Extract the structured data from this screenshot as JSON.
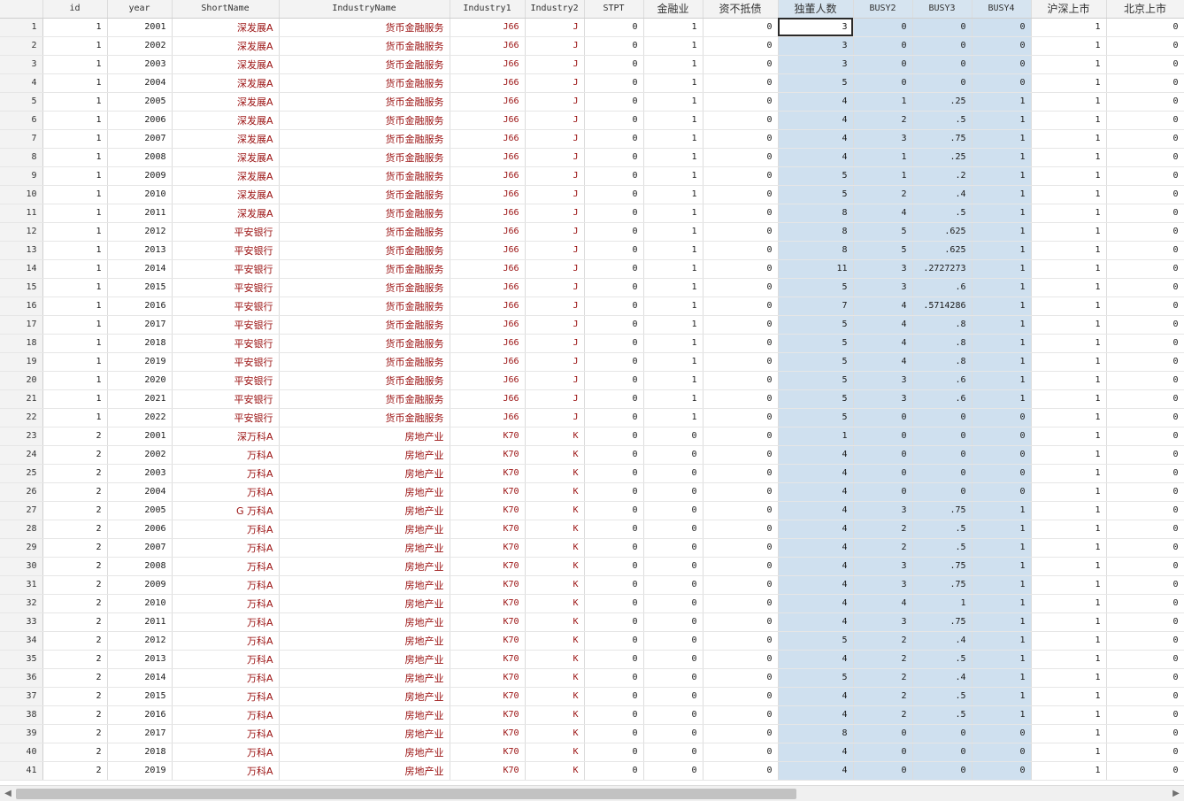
{
  "columns": [
    "id",
    "year",
    "ShortName",
    "IndustryName",
    "Industry1",
    "Industry2",
    "STPT",
    "金融业",
    "资不抵债",
    "独董人数",
    "BUSY2",
    "BUSY3",
    "BUSY4",
    "沪深上市",
    "北京上市"
  ],
  "rows": [
    [
      "1",
      "1",
      "2001",
      "深发展A",
      "货币金融服务",
      "J66",
      "J",
      "0",
      "1",
      "0",
      "3",
      "0",
      "0",
      "0",
      "1",
      "0"
    ],
    [
      "2",
      "1",
      "2002",
      "深发展A",
      "货币金融服务",
      "J66",
      "J",
      "0",
      "1",
      "0",
      "3",
      "0",
      "0",
      "0",
      "1",
      "0"
    ],
    [
      "3",
      "1",
      "2003",
      "深发展A",
      "货币金融服务",
      "J66",
      "J",
      "0",
      "1",
      "0",
      "3",
      "0",
      "0",
      "0",
      "1",
      "0"
    ],
    [
      "4",
      "1",
      "2004",
      "深发展A",
      "货币金融服务",
      "J66",
      "J",
      "0",
      "1",
      "0",
      "5",
      "0",
      "0",
      "0",
      "1",
      "0"
    ],
    [
      "5",
      "1",
      "2005",
      "深发展A",
      "货币金融服务",
      "J66",
      "J",
      "0",
      "1",
      "0",
      "4",
      "1",
      ".25",
      "1",
      "1",
      "0"
    ],
    [
      "6",
      "1",
      "2006",
      "深发展A",
      "货币金融服务",
      "J66",
      "J",
      "0",
      "1",
      "0",
      "4",
      "2",
      ".5",
      "1",
      "1",
      "0"
    ],
    [
      "7",
      "1",
      "2007",
      "深发展A",
      "货币金融服务",
      "J66",
      "J",
      "0",
      "1",
      "0",
      "4",
      "3",
      ".75",
      "1",
      "1",
      "0"
    ],
    [
      "8",
      "1",
      "2008",
      "深发展A",
      "货币金融服务",
      "J66",
      "J",
      "0",
      "1",
      "0",
      "4",
      "1",
      ".25",
      "1",
      "1",
      "0"
    ],
    [
      "9",
      "1",
      "2009",
      "深发展A",
      "货币金融服务",
      "J66",
      "J",
      "0",
      "1",
      "0",
      "5",
      "1",
      ".2",
      "1",
      "1",
      "0"
    ],
    [
      "10",
      "1",
      "2010",
      "深发展A",
      "货币金融服务",
      "J66",
      "J",
      "0",
      "1",
      "0",
      "5",
      "2",
      ".4",
      "1",
      "1",
      "0"
    ],
    [
      "11",
      "1",
      "2011",
      "深发展A",
      "货币金融服务",
      "J66",
      "J",
      "0",
      "1",
      "0",
      "8",
      "4",
      ".5",
      "1",
      "1",
      "0"
    ],
    [
      "12",
      "1",
      "2012",
      "平安银行",
      "货币金融服务",
      "J66",
      "J",
      "0",
      "1",
      "0",
      "8",
      "5",
      ".625",
      "1",
      "1",
      "0"
    ],
    [
      "13",
      "1",
      "2013",
      "平安银行",
      "货币金融服务",
      "J66",
      "J",
      "0",
      "1",
      "0",
      "8",
      "5",
      ".625",
      "1",
      "1",
      "0"
    ],
    [
      "14",
      "1",
      "2014",
      "平安银行",
      "货币金融服务",
      "J66",
      "J",
      "0",
      "1",
      "0",
      "11",
      "3",
      ".2727273",
      "1",
      "1",
      "0"
    ],
    [
      "15",
      "1",
      "2015",
      "平安银行",
      "货币金融服务",
      "J66",
      "J",
      "0",
      "1",
      "0",
      "5",
      "3",
      ".6",
      "1",
      "1",
      "0"
    ],
    [
      "16",
      "1",
      "2016",
      "平安银行",
      "货币金融服务",
      "J66",
      "J",
      "0",
      "1",
      "0",
      "7",
      "4",
      ".5714286",
      "1",
      "1",
      "0"
    ],
    [
      "17",
      "1",
      "2017",
      "平安银行",
      "货币金融服务",
      "J66",
      "J",
      "0",
      "1",
      "0",
      "5",
      "4",
      ".8",
      "1",
      "1",
      "0"
    ],
    [
      "18",
      "1",
      "2018",
      "平安银行",
      "货币金融服务",
      "J66",
      "J",
      "0",
      "1",
      "0",
      "5",
      "4",
      ".8",
      "1",
      "1",
      "0"
    ],
    [
      "19",
      "1",
      "2019",
      "平安银行",
      "货币金融服务",
      "J66",
      "J",
      "0",
      "1",
      "0",
      "5",
      "4",
      ".8",
      "1",
      "1",
      "0"
    ],
    [
      "20",
      "1",
      "2020",
      "平安银行",
      "货币金融服务",
      "J66",
      "J",
      "0",
      "1",
      "0",
      "5",
      "3",
      ".6",
      "1",
      "1",
      "0"
    ],
    [
      "21",
      "1",
      "2021",
      "平安银行",
      "货币金融服务",
      "J66",
      "J",
      "0",
      "1",
      "0",
      "5",
      "3",
      ".6",
      "1",
      "1",
      "0"
    ],
    [
      "22",
      "1",
      "2022",
      "平安银行",
      "货币金融服务",
      "J66",
      "J",
      "0",
      "1",
      "0",
      "5",
      "0",
      "0",
      "0",
      "1",
      "0"
    ],
    [
      "23",
      "2",
      "2001",
      "深万科A",
      "房地产业",
      "K70",
      "K",
      "0",
      "0",
      "0",
      "1",
      "0",
      "0",
      "0",
      "1",
      "0"
    ],
    [
      "24",
      "2",
      "2002",
      "万科A",
      "房地产业",
      "K70",
      "K",
      "0",
      "0",
      "0",
      "4",
      "0",
      "0",
      "0",
      "1",
      "0"
    ],
    [
      "25",
      "2",
      "2003",
      "万科A",
      "房地产业",
      "K70",
      "K",
      "0",
      "0",
      "0",
      "4",
      "0",
      "0",
      "0",
      "1",
      "0"
    ],
    [
      "26",
      "2",
      "2004",
      "万科A",
      "房地产业",
      "K70",
      "K",
      "0",
      "0",
      "0",
      "4",
      "0",
      "0",
      "0",
      "1",
      "0"
    ],
    [
      "27",
      "2",
      "2005",
      "G 万科A",
      "房地产业",
      "K70",
      "K",
      "0",
      "0",
      "0",
      "4",
      "3",
      ".75",
      "1",
      "1",
      "0"
    ],
    [
      "28",
      "2",
      "2006",
      "万科A",
      "房地产业",
      "K70",
      "K",
      "0",
      "0",
      "0",
      "4",
      "2",
      ".5",
      "1",
      "1",
      "0"
    ],
    [
      "29",
      "2",
      "2007",
      "万科A",
      "房地产业",
      "K70",
      "K",
      "0",
      "0",
      "0",
      "4",
      "2",
      ".5",
      "1",
      "1",
      "0"
    ],
    [
      "30",
      "2",
      "2008",
      "万科A",
      "房地产业",
      "K70",
      "K",
      "0",
      "0",
      "0",
      "4",
      "3",
      ".75",
      "1",
      "1",
      "0"
    ],
    [
      "31",
      "2",
      "2009",
      "万科A",
      "房地产业",
      "K70",
      "K",
      "0",
      "0",
      "0",
      "4",
      "3",
      ".75",
      "1",
      "1",
      "0"
    ],
    [
      "32",
      "2",
      "2010",
      "万科A",
      "房地产业",
      "K70",
      "K",
      "0",
      "0",
      "0",
      "4",
      "4",
      "1",
      "1",
      "1",
      "0"
    ],
    [
      "33",
      "2",
      "2011",
      "万科A",
      "房地产业",
      "K70",
      "K",
      "0",
      "0",
      "0",
      "4",
      "3",
      ".75",
      "1",
      "1",
      "0"
    ],
    [
      "34",
      "2",
      "2012",
      "万科A",
      "房地产业",
      "K70",
      "K",
      "0",
      "0",
      "0",
      "5",
      "2",
      ".4",
      "1",
      "1",
      "0"
    ],
    [
      "35",
      "2",
      "2013",
      "万科A",
      "房地产业",
      "K70",
      "K",
      "0",
      "0",
      "0",
      "4",
      "2",
      ".5",
      "1",
      "1",
      "0"
    ],
    [
      "36",
      "2",
      "2014",
      "万科A",
      "房地产业",
      "K70",
      "K",
      "0",
      "0",
      "0",
      "5",
      "2",
      ".4",
      "1",
      "1",
      "0"
    ],
    [
      "37",
      "2",
      "2015",
      "万科A",
      "房地产业",
      "K70",
      "K",
      "0",
      "0",
      "0",
      "4",
      "2",
      ".5",
      "1",
      "1",
      "0"
    ],
    [
      "38",
      "2",
      "2016",
      "万科A",
      "房地产业",
      "K70",
      "K",
      "0",
      "0",
      "0",
      "4",
      "2",
      ".5",
      "1",
      "1",
      "0"
    ],
    [
      "39",
      "2",
      "2017",
      "万科A",
      "房地产业",
      "K70",
      "K",
      "0",
      "0",
      "0",
      "8",
      "0",
      "0",
      "0",
      "1",
      "0"
    ],
    [
      "40",
      "2",
      "2018",
      "万科A",
      "房地产业",
      "K70",
      "K",
      "0",
      "0",
      "0",
      "4",
      "0",
      "0",
      "0",
      "1",
      "0"
    ],
    [
      "41",
      "2",
      "2019",
      "万科A",
      "房地产业",
      "K70",
      "K",
      "0",
      "0",
      "0",
      "4",
      "0",
      "0",
      "0",
      "1",
      "0"
    ]
  ],
  "scrollbar": {
    "left_icon": "arrow-left-icon",
    "right_icon": "arrow-right-icon"
  },
  "colors": {
    "string_text": "#9a1010",
    "selection": "#cfe0ef",
    "header_bg": "#f3f3f3"
  }
}
